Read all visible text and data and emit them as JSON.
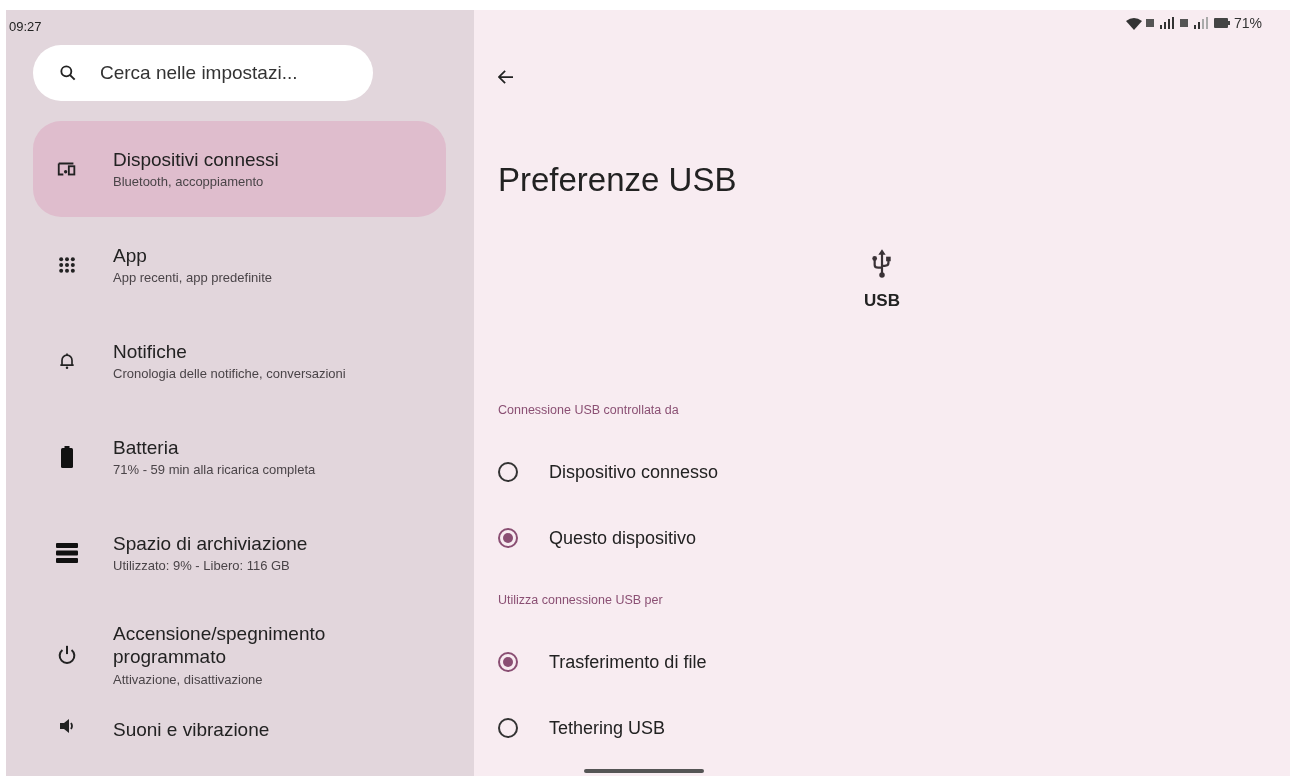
{
  "status_bar": {
    "time": "09:27",
    "battery": "71%"
  },
  "search": {
    "placeholder": "Cerca nelle impostazi..."
  },
  "sidebar": {
    "items": [
      {
        "title": "Dispositivi connessi",
        "subtitle": "Bluetooth, accoppiamento",
        "selected": true
      },
      {
        "title": "App",
        "subtitle": "App recenti, app predefinite",
        "selected": false
      },
      {
        "title": "Notifiche",
        "subtitle": "Cronologia delle notifiche, conversazioni",
        "selected": false
      },
      {
        "title": "Batteria",
        "subtitle": "71% - 59 min alla ricarica completa",
        "selected": false
      },
      {
        "title": "Spazio di archiviazione",
        "subtitle": "Utilizzato: 9% - Libero: 116 GB",
        "selected": false
      },
      {
        "title": "Accensione/spegnimento programmato",
        "subtitle": "Attivazione, disattivazione",
        "selected": false
      },
      {
        "title": "Suoni e vibrazione",
        "selected": false
      }
    ]
  },
  "page": {
    "title": "Preferenze USB",
    "device_label": "USB",
    "sections": [
      {
        "header": "Connessione USB controllata da",
        "options": [
          {
            "label": "Dispositivo connesso",
            "selected": false
          },
          {
            "label": "Questo dispositivo",
            "selected": true
          }
        ]
      },
      {
        "header": "Utilizza connessione USB per",
        "options": [
          {
            "label": "Trasferimento di file",
            "selected": true
          },
          {
            "label": "Tethering USB",
            "selected": false
          }
        ]
      }
    ]
  }
}
